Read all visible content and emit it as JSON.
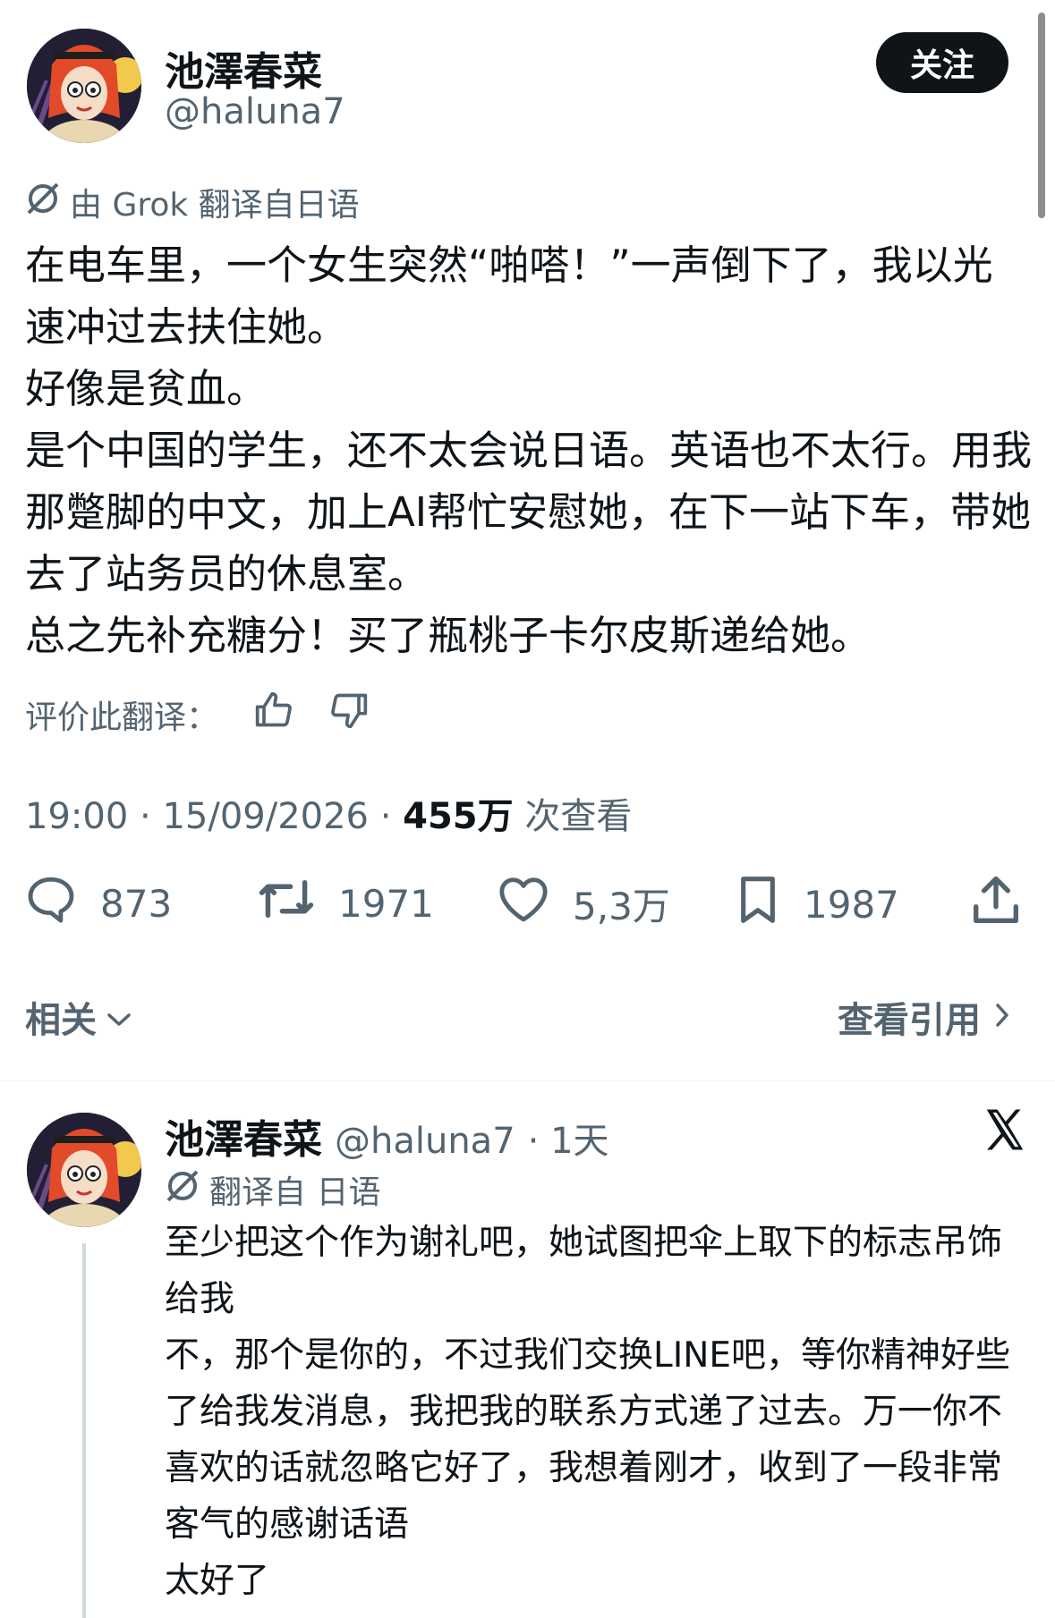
{
  "tweet": {
    "author_name": "池澤春菜",
    "handle": "@haluna7",
    "follow_label": "关注",
    "translate_prefix": "由 Grok 翻译自日语",
    "body": [
      "在电车里，一个女生突然“啪嗒！”一声倒下了，我以光速冲过去扶住她。",
      "好像是贫血。",
      "是个中国的学生，还不太会说日语。英语也不太行。用我那蹩脚的中文，加上AI帮忙安慰她，在下一站下车，带她去了站务员的休息室。",
      "总之先补充糖分！买了瓶桃子卡尔皮斯递给她。"
    ],
    "rate_label": "评价此翻译：",
    "time": "19:00",
    "date": "15/09/2026",
    "sep": "·",
    "views_count": "455万",
    "views_label": "次查看",
    "replies": "873",
    "retweets": "1971",
    "likes": "5,3万",
    "bookmarks": "1987",
    "related_label": "相关",
    "quotes_label": "查看引用"
  },
  "reply": {
    "author_name": "池澤春菜",
    "handle": "@haluna7",
    "time_ago": "· 1天",
    "translate_label": "翻译自 日语",
    "body": [
      "至少把这个作为谢礼吧，她试图把伞上取下的标志吊饰给我",
      "不，那个是你的，不过我们交换LINE吧，等你精神好些了给我发消息，我把我的联系方式递了过去。万一你不喜欢的话就忽略它好了，我想着刚才，收到了一段非常客气的感谢话语",
      "太好了"
    ]
  },
  "colors": {
    "text": "#0f1419",
    "secondary": "#536471",
    "button_bg": "#0f1419",
    "divider": "#eff3f4"
  },
  "icons": [
    "grok-translate-icon",
    "thumbs-up-icon",
    "thumbs-down-icon",
    "reply-icon",
    "retweet-icon",
    "like-icon",
    "bookmark-icon",
    "share-icon",
    "chevron-down-icon",
    "chevron-right-icon",
    "x-logo-icon"
  ]
}
